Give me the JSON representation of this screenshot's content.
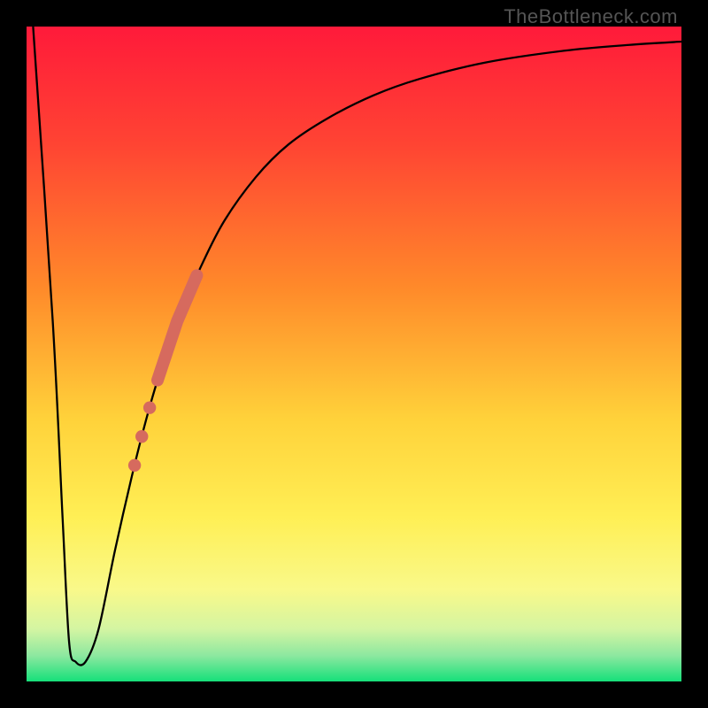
{
  "watermark": "TheBottleneck.com",
  "colors": {
    "frame": "#000000",
    "watermark": "#555555",
    "curve": "#000000",
    "marker": "#d66a5e",
    "gradient_stops": [
      {
        "pct": 0,
        "color": "#ff1a3a"
      },
      {
        "pct": 18,
        "color": "#ff4433"
      },
      {
        "pct": 40,
        "color": "#ff8a2a"
      },
      {
        "pct": 60,
        "color": "#ffd23a"
      },
      {
        "pct": 75,
        "color": "#ffef55"
      },
      {
        "pct": 86,
        "color": "#f9f98a"
      },
      {
        "pct": 92,
        "color": "#d4f5a2"
      },
      {
        "pct": 96,
        "color": "#8ee8a0"
      },
      {
        "pct": 100,
        "color": "#16e07a"
      }
    ]
  },
  "chart_data": {
    "type": "line",
    "title": "",
    "xlabel": "",
    "ylabel": "",
    "xlim": [
      0,
      100
    ],
    "ylim": [
      0,
      100
    ],
    "grid": false,
    "series": [
      {
        "name": "bottleneck-curve",
        "x": [
          1,
          4,
          5.5,
          6.5,
          7.5,
          9,
          11,
          13.5,
          16,
          18,
          20,
          23,
          26,
          30,
          35,
          40,
          46,
          53,
          60,
          70,
          82,
          92,
          100
        ],
        "y": [
          100,
          55,
          25,
          6,
          3,
          3,
          8,
          20,
          31,
          39,
          46,
          55,
          62,
          70,
          77,
          82,
          86,
          89.5,
          92,
          94.5,
          96.3,
          97.2,
          97.7
        ]
      }
    ],
    "markers": {
      "name": "highlighted-points",
      "shape": "circle",
      "color": "#d66a5e",
      "on_curve_x": [
        16.5,
        17.6,
        18.8
      ],
      "thick_segment_x": [
        20.0,
        26.0
      ]
    },
    "flat_bottom": {
      "x_from": 6.8,
      "x_to": 8.8,
      "y": 3
    }
  }
}
